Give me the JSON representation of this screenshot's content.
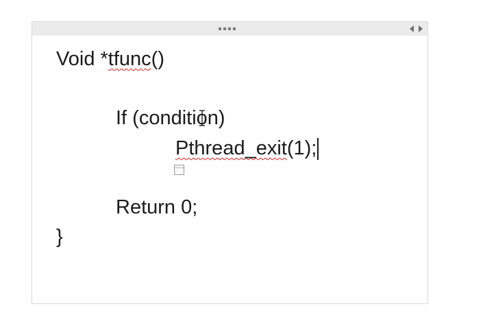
{
  "note": {
    "lines": {
      "l1_prefix": "Void *",
      "l1_func": "tfunc",
      "l1_suffix": "()",
      "l2": "If (condition)",
      "l3_func": "Pthread_exit",
      "l3_suffix": "(1);",
      "l4": "Return 0;",
      "l5": "}"
    }
  },
  "colors": {
    "spellcheck": "#e02020",
    "titlebar": "#ebebeb",
    "text": "#1b1b1b"
  },
  "icons": {
    "drag": "drag-handle-icon",
    "resize": "resize-arrows-icon",
    "paste": "paste-options-icon",
    "cursor": "ibeam-cursor-icon"
  }
}
